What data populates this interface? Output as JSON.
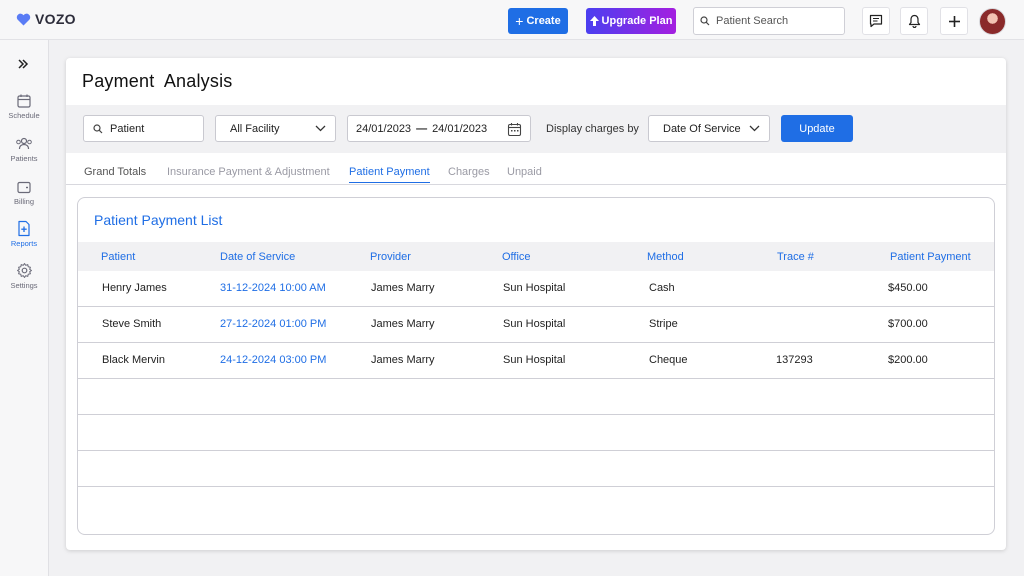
{
  "app": {
    "logo_text": "VOZO",
    "brand_color": "#1f6ee5"
  },
  "topbar": {
    "create_label": "Create",
    "upgrade_label": "Upgrade Plan",
    "search_placeholder": "Patient Search"
  },
  "sidebar": {
    "items": [
      {
        "label": "Schedule",
        "icon": "calendar-icon"
      },
      {
        "label": "Patients",
        "icon": "users-icon"
      },
      {
        "label": "Billing",
        "icon": "wallet-icon"
      },
      {
        "label": "Reports",
        "icon": "report-icon",
        "active": true
      },
      {
        "label": "Settings",
        "icon": "gear-icon"
      }
    ]
  },
  "page": {
    "title": "Payment  Analysis"
  },
  "filters": {
    "patient_value": "Patient",
    "facility_value": "All Facility",
    "date_from": "24/01/2023",
    "date_to": "24/01/2023",
    "display_label": "Display charges by",
    "display_value": "Date Of Service",
    "update_label": "Update"
  },
  "tabs": [
    "Grand Totals",
    "Insurance Payment & Adjustment",
    "Patient Payment",
    "Charges",
    "Unpaid"
  ],
  "active_tab": "Patient Payment",
  "list": {
    "title": "Patient Payment List",
    "columns": [
      "Patient",
      "Date of Service",
      "Provider",
      "Office",
      "Method",
      "Trace #",
      "Patient Payment"
    ],
    "rows": [
      [
        "Henry James",
        "31-12-2024 10:00 AM",
        "James Marry",
        "Sun Hospital",
        "Cash",
        "",
        "$450.00"
      ],
      [
        "Steve Smith",
        "27-12-2024 01:00 PM",
        "James Marry",
        "Sun Hospital",
        "Stripe",
        "",
        "$700.00"
      ],
      [
        "Black Mervin",
        "24-12-2024 03:00 PM",
        "James Marry",
        "Sun Hospital",
        "Cheque",
        "137293",
        "$200.00"
      ]
    ]
  }
}
